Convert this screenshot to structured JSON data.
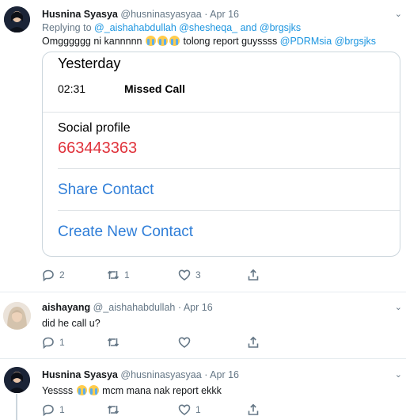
{
  "tweets": [
    {
      "name": "Husnina Syasya",
      "handle": "@husninasyasyaa",
      "dot": "·",
      "date": "Apr 16",
      "replying_prefix": "Replying to",
      "replying_handles": "@_aishahabdullah @shesheqa_ and @brgsjks",
      "text_before": "Omgggggg ni kannnnn",
      "text_after": "tolong report guyssss",
      "mentions": "@PDRMsia @brgsjks",
      "emoji": "loudly-crying-face",
      "replies": "2",
      "retweets": "1",
      "likes": "3"
    },
    {
      "name": "aishayang",
      "handle": "@_aishahabdullah",
      "dot": "·",
      "date": "Apr 16",
      "text": "did he call u?",
      "replies": "1",
      "retweets": "",
      "likes": ""
    },
    {
      "name": "Husnina Syasya",
      "handle": "@husninasyasyaa",
      "dot": "·",
      "date": "Apr 16",
      "text_before": "Yessss",
      "text_after": "mcm mana nak report ekkk",
      "replies": "1",
      "retweets": "",
      "likes": "1"
    }
  ],
  "call_card": {
    "day": "Yesterday",
    "time": "02:31",
    "call_type": "Missed Call",
    "profile_label": "Social profile",
    "number": "663443363",
    "share": "Share Contact",
    "create": "Create New Contact"
  },
  "colors": {
    "link": "#1b95e0",
    "ios_link": "#2f7ed8",
    "number": "#e0323b",
    "muted": "#657786"
  },
  "icons": {
    "caret": "chevron-down-icon",
    "reply": "reply-icon",
    "retweet": "retweet-icon",
    "like": "heart-icon",
    "share": "share-icon"
  }
}
